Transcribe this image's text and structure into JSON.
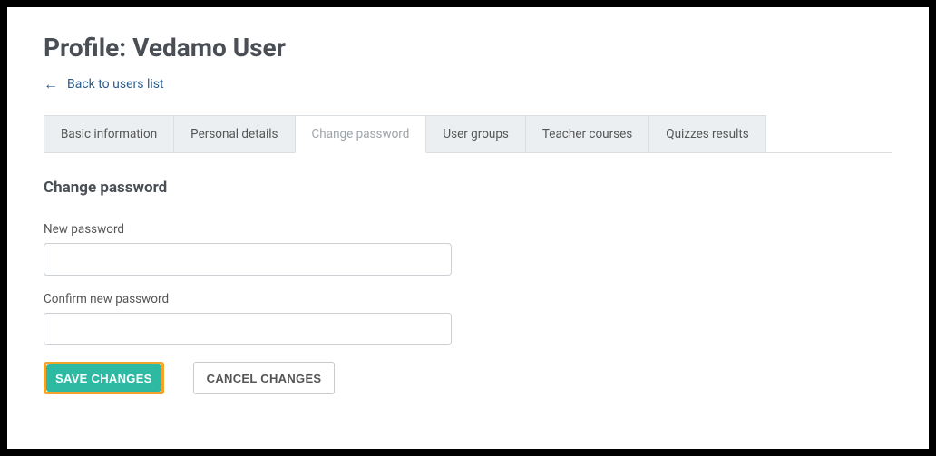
{
  "header": {
    "title": "Profile: Vedamo User",
    "back_link_label": "Back to users list"
  },
  "tabs": [
    {
      "label": "Basic information",
      "active": false
    },
    {
      "label": "Personal details",
      "active": false
    },
    {
      "label": "Change password",
      "active": true
    },
    {
      "label": "User groups",
      "active": false
    },
    {
      "label": "Teacher courses",
      "active": false
    },
    {
      "label": "Quizzes results",
      "active": false
    }
  ],
  "section": {
    "heading": "Change password",
    "new_password_label": "New password",
    "new_password_value": "",
    "confirm_password_label": "Confirm new password",
    "confirm_password_value": ""
  },
  "actions": {
    "save_label": "SAVE CHANGES",
    "cancel_label": "CANCEL CHANGES"
  }
}
